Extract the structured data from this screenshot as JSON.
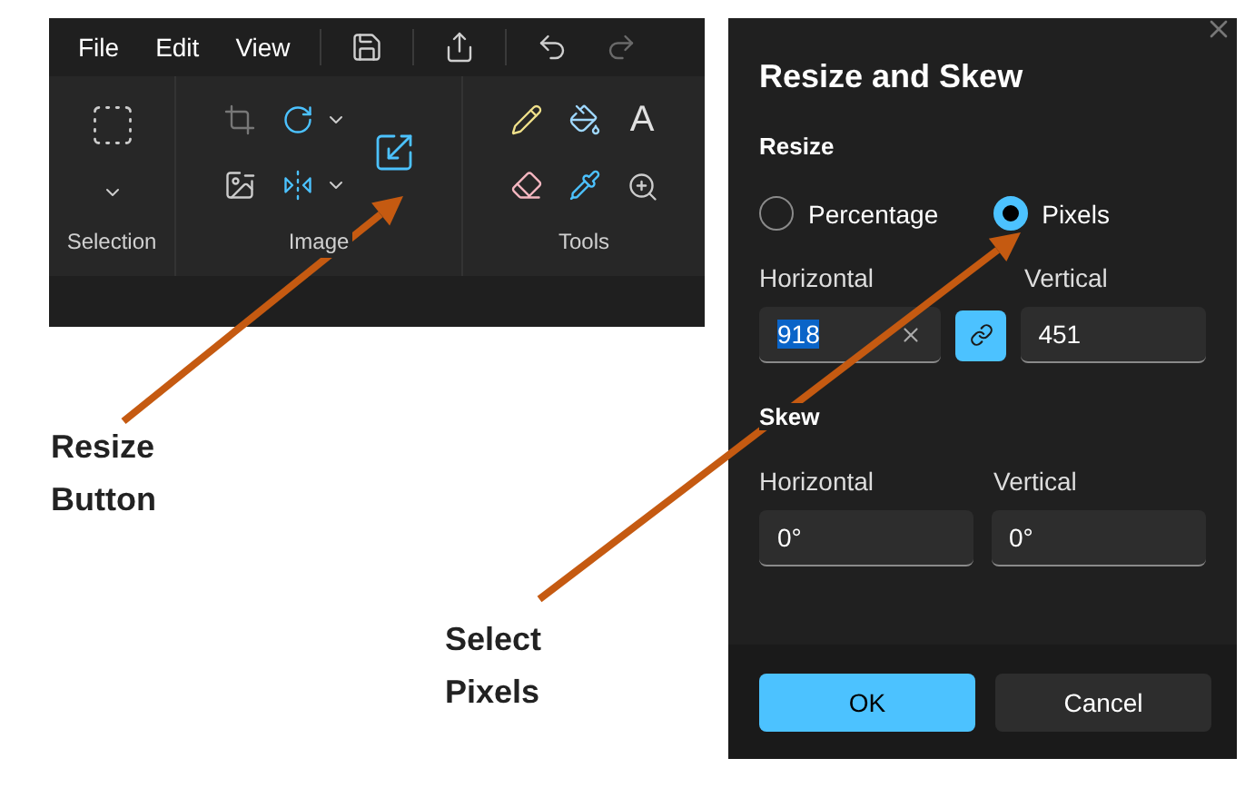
{
  "menu": [
    {
      "label": "File"
    },
    {
      "label": "Edit"
    },
    {
      "label": "View"
    }
  ],
  "toolbar": [
    {
      "kind": "save",
      "disabled": false
    },
    {
      "kind": "share",
      "disabled": false
    },
    {
      "kind": "undo",
      "disabled": false
    },
    {
      "kind": "redo",
      "disabled": true
    }
  ],
  "ribbon": {
    "groups": [
      {
        "label": "Selection"
      },
      {
        "label": "Image"
      },
      {
        "label": "Tools"
      }
    ],
    "text_tool_glyph": "A"
  },
  "annotations": [
    {
      "lines": [
        "Resize",
        "Button"
      ]
    },
    {
      "lines": [
        "Select",
        "Pixels"
      ]
    }
  ],
  "dialog": {
    "title": "Resize and Skew",
    "resize": {
      "heading": "Resize",
      "options": [
        {
          "label": "Percentage",
          "selected": false
        },
        {
          "label": "Pixels",
          "selected": true
        }
      ],
      "horizontal": {
        "label": "Horizontal",
        "value": "918",
        "text_selected": true
      },
      "aspect_locked": true,
      "vertical": {
        "label": "Vertical",
        "value": "451"
      }
    },
    "skew": {
      "heading": "Skew",
      "horizontal": {
        "label": "Horizontal",
        "value": "0°"
      },
      "vertical": {
        "label": "Vertical",
        "value": "0°"
      }
    },
    "buttons": [
      {
        "label": "OK",
        "kind": "primary"
      },
      {
        "label": "Cancel",
        "kind": "secondary"
      }
    ]
  }
}
